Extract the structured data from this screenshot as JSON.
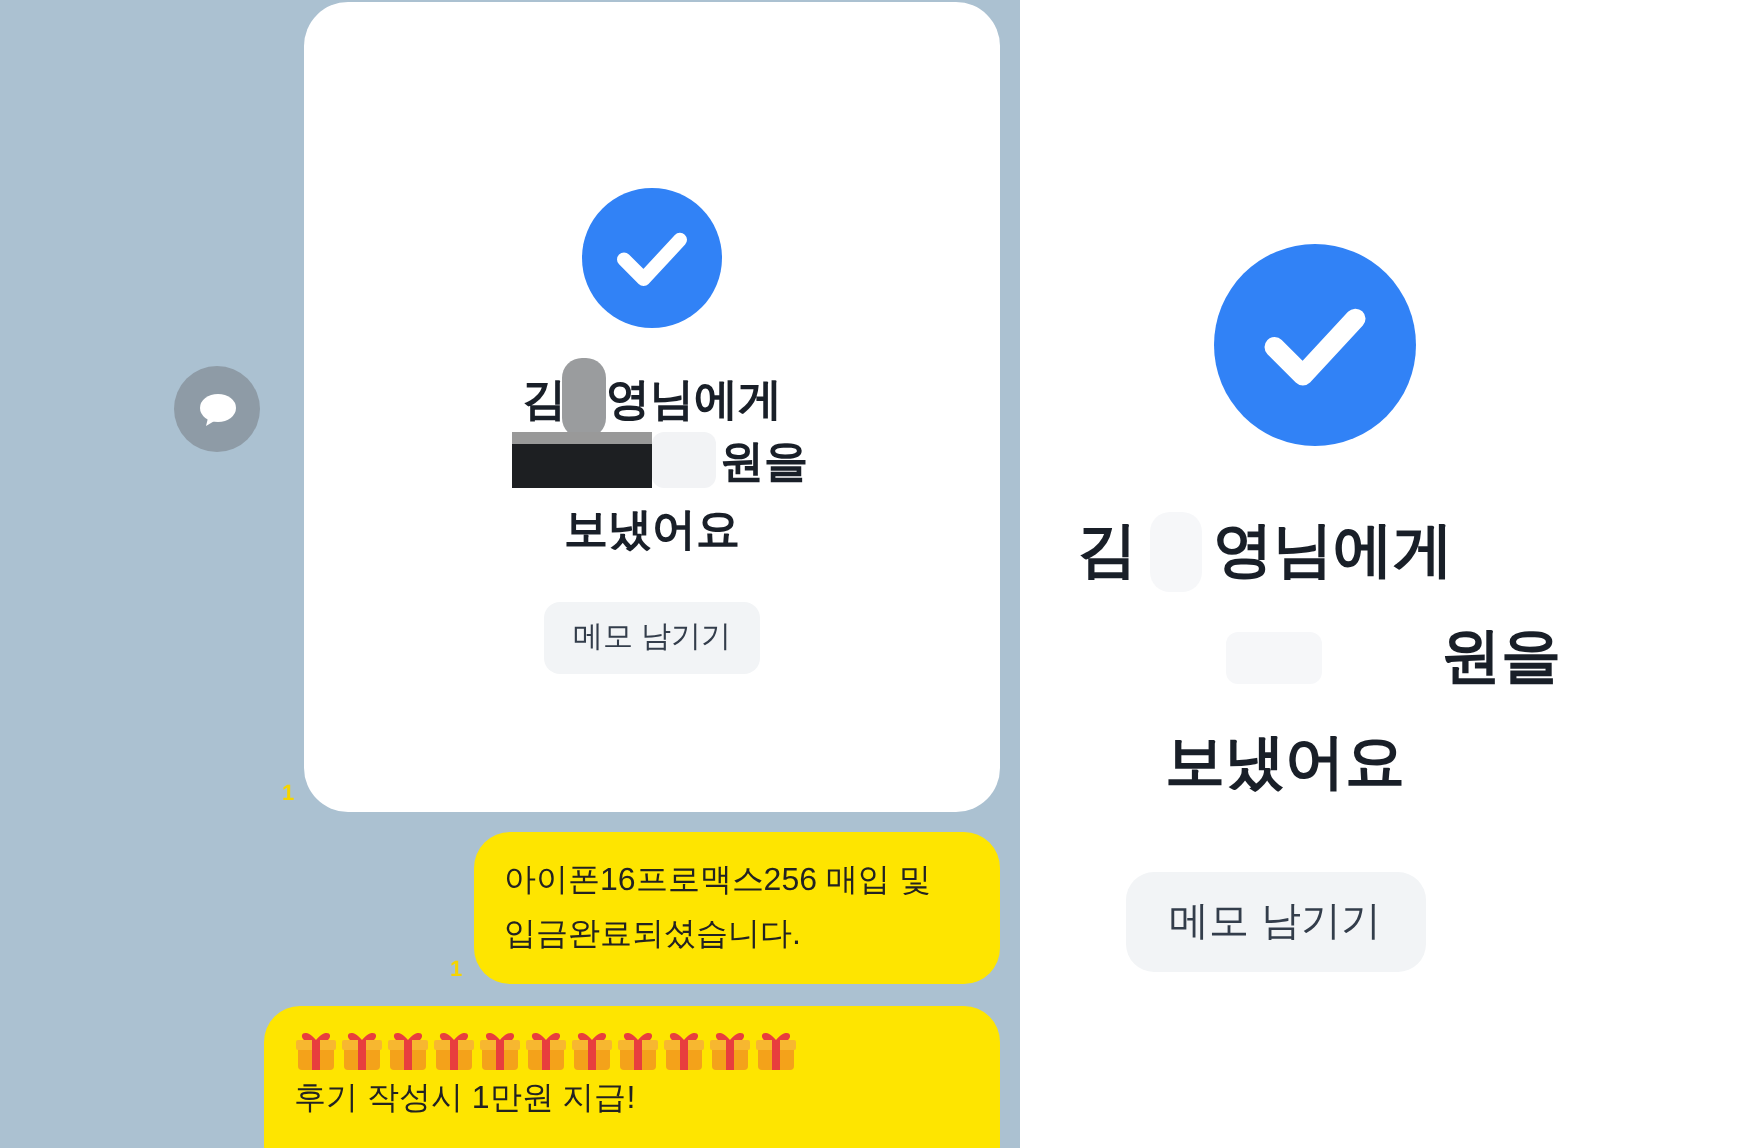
{
  "chat": {
    "transfer_card": {
      "name_start": "김",
      "name_end": "영님에게",
      "amount_suffix": "원을",
      "sent": "보냈어요",
      "button": "메모 남기기",
      "unread": "1"
    },
    "messages": [
      {
        "kind": "text",
        "lines": [
          "아이폰16프로맥스256 매입 및",
          "입금완료되셨습니다."
        ],
        "unread": "1"
      },
      {
        "kind": "promo",
        "gifts": [
          {
            "kind": "gift"
          },
          {
            "kind": "gift"
          },
          {
            "kind": "gift"
          },
          {
            "kind": "gift"
          },
          {
            "kind": "gift"
          },
          {
            "kind": "gift"
          },
          {
            "kind": "gift"
          },
          {
            "kind": "gift"
          },
          {
            "kind": "gift"
          },
          {
            "kind": "gift"
          },
          {
            "kind": "gift"
          }
        ],
        "text": "후기 작성시 1만원 지급!"
      }
    ]
  },
  "detail": {
    "name_start": "김",
    "name_end": "영님에게",
    "amount_suffix": "원을",
    "sent": "보냈어요",
    "button": "메모 남기기"
  }
}
